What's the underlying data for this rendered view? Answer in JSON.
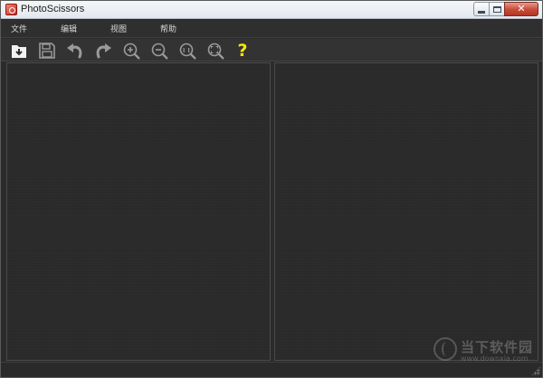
{
  "window": {
    "title": "PhotoScissors",
    "close_symbol": "✕"
  },
  "menu": {
    "items": [
      {
        "label": "文件"
      },
      {
        "label": "编辑"
      },
      {
        "label": "视图"
      },
      {
        "label": "帮助"
      }
    ]
  },
  "toolbar": {
    "icons": [
      "open-icon",
      "save-icon",
      "undo-icon",
      "redo-icon",
      "zoom-in-icon",
      "zoom-out-icon",
      "zoom-actual-size-icon",
      "zoom-fit-icon",
      "help-icon"
    ],
    "help_symbol": "?",
    "help_color": "#ffe500"
  },
  "watermark": {
    "name": "当下软件园",
    "url": "www.downxia.com"
  }
}
